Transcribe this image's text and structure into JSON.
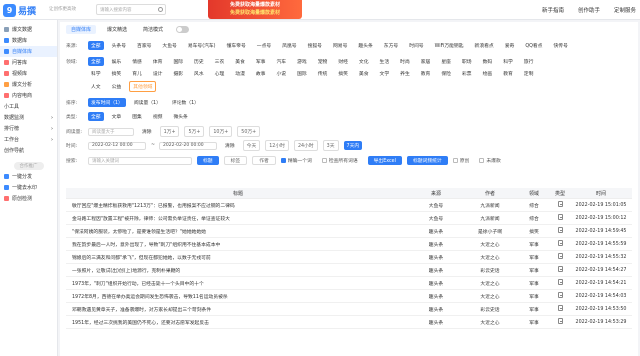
{
  "header": {
    "logo_mark": "9",
    "logo_text": "易撰",
    "slogan": "让创作更高效",
    "search_placeholder": "请输入搜索内容",
    "banner_line1": "免费获取海量爆款素材",
    "banner_line2": "免费获取海量爆款素材",
    "nav": [
      "新手指南",
      "创作助手",
      "定制服务"
    ]
  },
  "sidebar": {
    "items": [
      {
        "label": "爆文数据",
        "icon": "database-icon",
        "color": "#8aa0b8"
      },
      {
        "label": "数据库",
        "icon": "database-icon",
        "color": "#3c8bff"
      },
      {
        "label": "自媒体库",
        "icon": "media-library-icon",
        "color": "#3c8bff",
        "active": true
      },
      {
        "label": "问答库",
        "icon": "qa-icon",
        "color": "#ff6f6f"
      },
      {
        "label": "视频库",
        "icon": "video-icon",
        "color": "#ff6f6f"
      },
      {
        "label": "爆文分析",
        "icon": "analysis-icon",
        "color": "#ff9f43"
      },
      {
        "label": "内容电商",
        "icon": "ecommerce-icon",
        "color": "#ff6f6f"
      }
    ],
    "groups": [
      "小工具",
      "数据监测",
      "排行榜",
      "工作台",
      "创作导航"
    ],
    "sep_label": "合作推广",
    "links": [
      {
        "label": "一键分发",
        "icon": "share-icon",
        "color": "#3c8bff"
      },
      {
        "label": "一键去水印",
        "icon": "watermark-icon",
        "color": "#3c8bff"
      },
      {
        "label": "原创检测",
        "icon": "check-icon",
        "color": "#ff6f6f"
      }
    ]
  },
  "tabs": {
    "items": [
      "自媒体库",
      "爆文精选"
    ],
    "active": 0,
    "mode_label": "简洁模式"
  },
  "filters": {
    "source": {
      "label": "来源:",
      "options": [
        "全部",
        "头条号",
        "百家号",
        "大鱼号",
        "易车号(汽车)",
        "懂车帝号",
        "一点号",
        "凤凰号",
        "搜狐号",
        "网易号",
        "趣头条",
        "东方号",
        "时间号",
        "WiFi万能钥匙",
        "新浪看点",
        "爱奇",
        "QQ看点",
        "快传号"
      ]
    },
    "field": {
      "label": "领域:",
      "row1": [
        "全部",
        "娱乐",
        "情感",
        "体育",
        "国际",
        "历史",
        "三农",
        "美食",
        "军事",
        "汽车",
        "游戏",
        "宠物",
        "财经",
        "文化",
        "生活",
        "时尚",
        "家居",
        "星座",
        "职场",
        "数码",
        "科学",
        "旅行"
      ],
      "row2": [
        "科学",
        "搞笑",
        "育儿",
        "设计",
        "摄影",
        "风水",
        "心理",
        "动漫",
        "故事",
        "小说",
        "国际",
        "传统",
        "搞笑",
        "美食",
        "文学",
        "养生",
        "教育",
        "保险",
        "彩票",
        "绘画",
        "教育",
        "定制"
      ],
      "row3": [
        "人文",
        "公益",
        "其他领域"
      ]
    },
    "sort": {
      "label": "排序:",
      "options": [
        "发布时间（1）",
        "阅读量（1）",
        "评论数（1）"
      ]
    },
    "type": {
      "label": "类型:",
      "options": [
        "全部",
        "文章",
        "图集",
        "视频",
        "微头条"
      ]
    },
    "reads": {
      "label": "阅读量:",
      "placeholder": "阅读量大于",
      "prefix": "清除",
      "options": [
        "1万+",
        "5万+",
        "10万+",
        "50万+"
      ]
    },
    "time": {
      "label": "时间:",
      "start": "2022-02-12 00:00",
      "end": "2022-02-20 00:00",
      "options": [
        "清除",
        "今天",
        "12小时",
        "24小时",
        "3天",
        "7天内"
      ]
    },
    "search": {
      "label": "搜索:",
      "placeholder": "请输入关键词",
      "btn_title": "标题",
      "btn_tag": "标签",
      "btn_author": "作者",
      "check_full": "精确一个词",
      "check_fuzzy": "检查所有词语",
      "export_label": "导出Excel",
      "stats_label": "标题词频统计",
      "original_label": "原创",
      "unread_label": "未爆款"
    }
  },
  "table": {
    "columns": [
      "标题",
      "来源",
      "作者",
      "领域",
      "类型",
      "时间"
    ],
    "rows": [
      {
        "title": "敏厅回应\"爆主精炸板获救用\"1213万\"：已报警，也用报案不应过钢的二律码",
        "source": "大鱼号",
        "author": "九派新闻",
        "field": "综合",
        "time": "2022-02-19 15:01:05"
      },
      {
        "title": "金马路工程因\"放置工程\"被开除，律师：公司需负举证责任，举证查证较大",
        "source": "大鱼号",
        "author": "九派新闻",
        "field": "综合",
        "time": "2022-02-19 15:00:12"
      },
      {
        "title": "\"保法阿姨的服装，太惨啦了，是要谁领是生活吧？\"她她她她她",
        "source": "趣头条",
        "author": "是徐小子啊",
        "field": "搞笑",
        "time": "2022-02-19 14:59:45"
      },
      {
        "title": "我在韵步最后一人时，意外出现了，导致\"刺刀\"组织用不住基本成本中",
        "source": "趣头条",
        "author": "大近之心",
        "field": "军事",
        "time": "2022-02-19 14:55:59"
      },
      {
        "title": "锦娘后的三满友和问都\"承飞\"，但现在都犯她她，以数于无戎可前",
        "source": "趣头条",
        "author": "大近之心",
        "field": "军事",
        "time": "2022-02-19 14:55:32"
      },
      {
        "title": "一张照片，让敬试(出)创(上)地源行，克制朴果鞭的",
        "source": "趣头条",
        "author": "彩云史话",
        "field": "军事",
        "time": "2022-02-19 14:54:27"
      },
      {
        "title": "1973年，\"刺刀\"组织开始行动，已经击毙十一个头目中的十个",
        "source": "趣头条",
        "author": "大近之心",
        "field": "军事",
        "time": "2022-02-19 14:54:21"
      },
      {
        "title": "1972年8月，西德在举办奥运会期间发生恐怖袭击，导致11名运动员被杀",
        "source": "趣头条",
        "author": "大近之心",
        "field": "军事",
        "time": "2022-02-19 14:54:03"
      },
      {
        "title": "邓朝救遇见黄章天子，准备袭爆时，对方家长却提出三个苛刻条件",
        "source": "趣头条",
        "author": "彩云史话",
        "field": "军事",
        "time": "2022-02-19 14:53:50"
      },
      {
        "title": "1951年，经过三次挑我的美国仍不死心，还要对志愿军发起反击",
        "source": "趣头条",
        "author": "大近之心",
        "field": "军事",
        "time": "2022-02-19 14:53:29"
      }
    ]
  },
  "colors": {
    "accent": "#2f7df6",
    "banner": "#e3382b"
  }
}
